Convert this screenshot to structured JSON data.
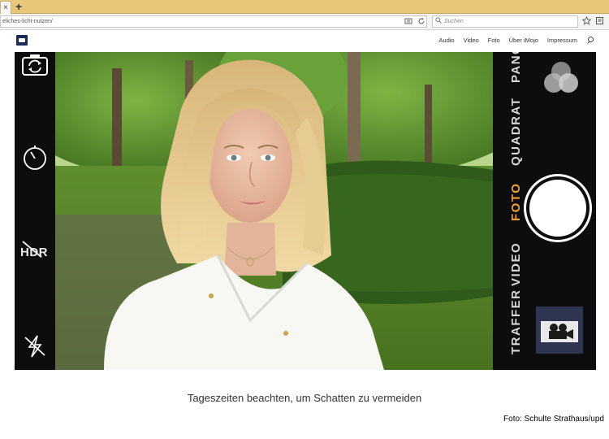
{
  "browser": {
    "tab_close_glyph": "×",
    "new_tab_glyph": "+",
    "url": "eliches-licht-nutzen/",
    "search_placeholder": "Suchen"
  },
  "site": {
    "menu": [
      {
        "label": "Audio"
      },
      {
        "label": "Video"
      },
      {
        "label": "Foto"
      },
      {
        "label": "Über iMojo"
      },
      {
        "label": "Impressum"
      }
    ]
  },
  "camera": {
    "hdr_label": "HDR",
    "modes": [
      "TRAFFER",
      "VIDEO",
      "FOTO",
      "QUADRAT",
      "PANO"
    ],
    "active_mode": "FOTO",
    "accent_color": "#f2a12e"
  },
  "caption": "Tageszeiten beachten, um Schatten zu vermeiden",
  "credit": "Foto: Schulte Strathaus/upd"
}
